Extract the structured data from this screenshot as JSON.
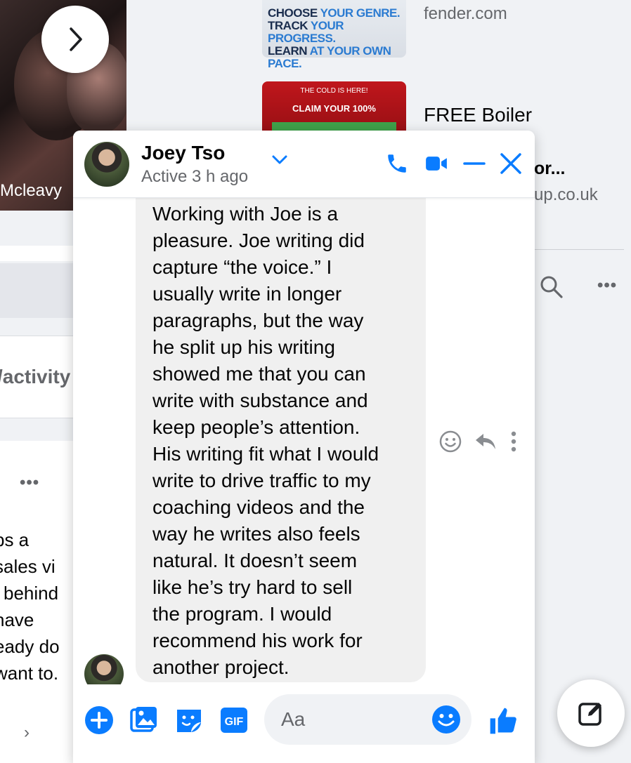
{
  "background": {
    "story_name": "Mcleavy",
    "feed_tab_label": "/activity",
    "feed_post_lines": [
      "bs a",
      "sales vi",
      "l behind",
      "have",
      "eady do",
      "want to."
    ],
    "ads": [
      {
        "image_lines": [
          [
            "CHOOSE ",
            "YOUR GENRE."
          ],
          [
            "TRACK ",
            "YOUR PROGRESS."
          ],
          [
            "LEARN ",
            "AT YOUR OWN PACE."
          ]
        ],
        "url": "fender.com"
      },
      {
        "image_small": "THE COLD IS HERE!",
        "image_big": "CLAIM YOUR 100%",
        "title": "FREE Boiler",
        "title_cont": "or...",
        "url": "up.co.uk"
      }
    ]
  },
  "chat": {
    "contact_name": "Joey Tso",
    "status": "Active 3 h ago",
    "message": "Working with Joe is a\npleasure. Joe writing did\ncapture “the voice.” I\nusually write in longer\nparagraphs, but the way\nhe split up his writing\nshowed me that you can\nwrite with substance and\nkeep people’s attention.\nHis writing fit what I would\nwrite to drive traffic to my\ncoaching videos and the\nway he writes also feels\nnatural. It doesn’t seem\nlike he’s try hard to sell\nthe program. I would\nrecommend his work for\nanother project.",
    "composer_placeholder": "Aa"
  },
  "colors": {
    "accent": "#0a7cff",
    "bubble": "#f0f0f0",
    "secondary_text": "#65676b"
  },
  "icons": [
    "chevron-right-icon",
    "chevron-down-icon",
    "phone-icon",
    "video-icon",
    "minimize-icon",
    "close-icon",
    "react-icon",
    "reply-icon",
    "more-icon",
    "plus-icon",
    "image-icon",
    "sticker-icon",
    "gif-icon",
    "emoji-icon",
    "thumbs-up-icon",
    "compose-icon",
    "search-icon"
  ]
}
